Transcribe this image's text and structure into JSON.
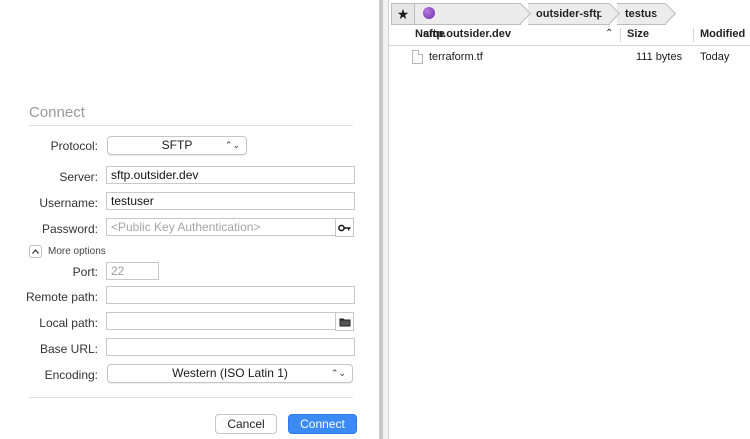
{
  "dialog": {
    "title": "Connect",
    "protocol": {
      "label": "Protocol:",
      "value": "SFTP"
    },
    "server": {
      "label": "Server:",
      "value": "sftp.outsider.dev"
    },
    "username": {
      "label": "Username:",
      "value": "testuser"
    },
    "password": {
      "label": "Password:",
      "placeholder": "<Public Key Authentication>"
    },
    "more_options": {
      "label": "More options",
      "expanded": true
    },
    "port": {
      "label": "Port:",
      "value": "22"
    },
    "remote_path": {
      "label": "Remote path:",
      "value": ""
    },
    "local_path": {
      "label": "Local path:",
      "value": ""
    },
    "base_url": {
      "label": "Base URL:",
      "value": ""
    },
    "encoding": {
      "label": "Encoding:",
      "value": "Western (ISO Latin 1)"
    },
    "buttons": {
      "cancel": "Cancel",
      "connect": "Connect"
    },
    "accent_color": "#3b8af5"
  },
  "browser": {
    "path": [
      "sftp.outsider.dev",
      "outsider-sftp",
      "testuser"
    ],
    "columns": {
      "name": "Name",
      "size": "Size",
      "modified": "Modified"
    },
    "files": [
      {
        "name": "terraform.tf",
        "size": "111 bytes",
        "modified": "Today"
      }
    ]
  },
  "icons": {
    "star": "star-icon",
    "globe": "globe-icon",
    "key": "key-icon",
    "folder": "folder-icon",
    "disclosure": "chevron-up-icon",
    "sort": "sort-up-icon",
    "file": "file-icon"
  }
}
